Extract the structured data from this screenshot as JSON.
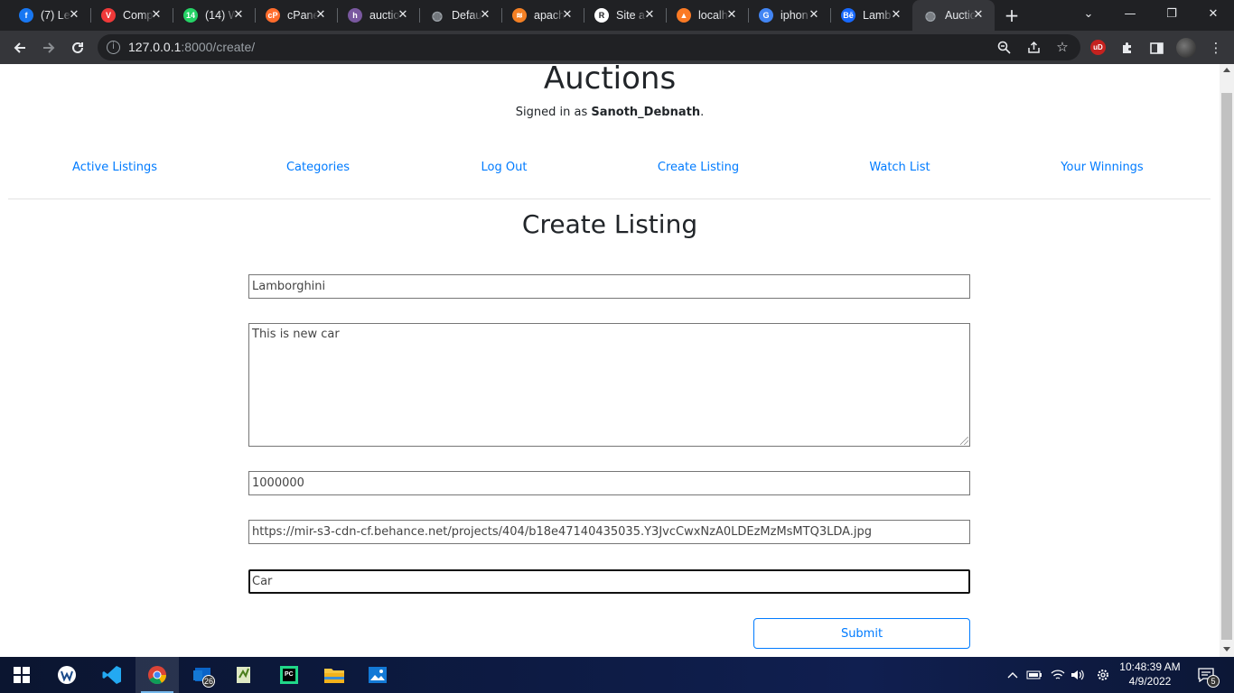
{
  "browser": {
    "tabs": [
      {
        "title": "(7) Le",
        "favicon": "facebook-icon",
        "color": "#1877f2",
        "glyph": "f"
      },
      {
        "title": "Comp",
        "favicon": "vivaldi-icon",
        "color": "#ef3939",
        "glyph": "V"
      },
      {
        "title": "(14) W",
        "favicon": "whatsapp-icon",
        "color": "#25d366",
        "glyph": "14"
      },
      {
        "title": "cPanel",
        "favicon": "cpanel-icon",
        "color": "#ff6c2c",
        "glyph": "cP"
      },
      {
        "title": "auctio",
        "favicon": "heroku-icon",
        "color": "#79589f",
        "glyph": "h"
      },
      {
        "title": "Defau",
        "favicon": "globe-icon",
        "color": "#9aa0a6",
        "glyph": "◍"
      },
      {
        "title": "apach",
        "favicon": "stackoverflow-icon",
        "color": "#f48024",
        "glyph": "≋"
      },
      {
        "title": "Site a",
        "favicon": "site-icon",
        "color": "#ffffff",
        "glyph": "R"
      },
      {
        "title": "localh",
        "favicon": "xampp-icon",
        "color": "#fb7a24",
        "glyph": "▲"
      },
      {
        "title": "iphon",
        "favicon": "google-icon",
        "color": "#4285f4",
        "glyph": "G"
      },
      {
        "title": "Lamb",
        "favicon": "behance-icon",
        "color": "#1769ff",
        "glyph": "Bē"
      },
      {
        "title": "Auctio",
        "favicon": "globe-icon",
        "color": "#9aa0a6",
        "glyph": "◍",
        "active": true
      }
    ],
    "url_host": "127.0.0.1",
    "url_rest": ":8000/create/",
    "ext_label": "uD"
  },
  "page": {
    "site_title": "Auctions",
    "signed_in_prefix": "Signed in as ",
    "username": "Sanoth_Debnath",
    "signed_in_suffix": ".",
    "nav": [
      "Active Listings",
      "Categories",
      "Log Out",
      "Create Listing",
      "Watch List",
      "Your Winnings"
    ],
    "heading": "Create Listing",
    "form": {
      "title_value": "Lamborghini",
      "description_value": "This is new car",
      "price_value": "1000000",
      "image_url_value": "https://mir-s3-cdn-cf.behance.net/projects/404/b18e47140435035.Y3JvcCwxNzA0LDEzMzMsMTQ3LDA.jpg",
      "category_value": "Car",
      "submit_label": "Submit"
    },
    "link_color": "#007bff"
  },
  "taskbar": {
    "clock_time": "10:48:39 AM",
    "clock_date": "4/9/2022",
    "teams_badge": "26",
    "notification_badge": "5"
  }
}
